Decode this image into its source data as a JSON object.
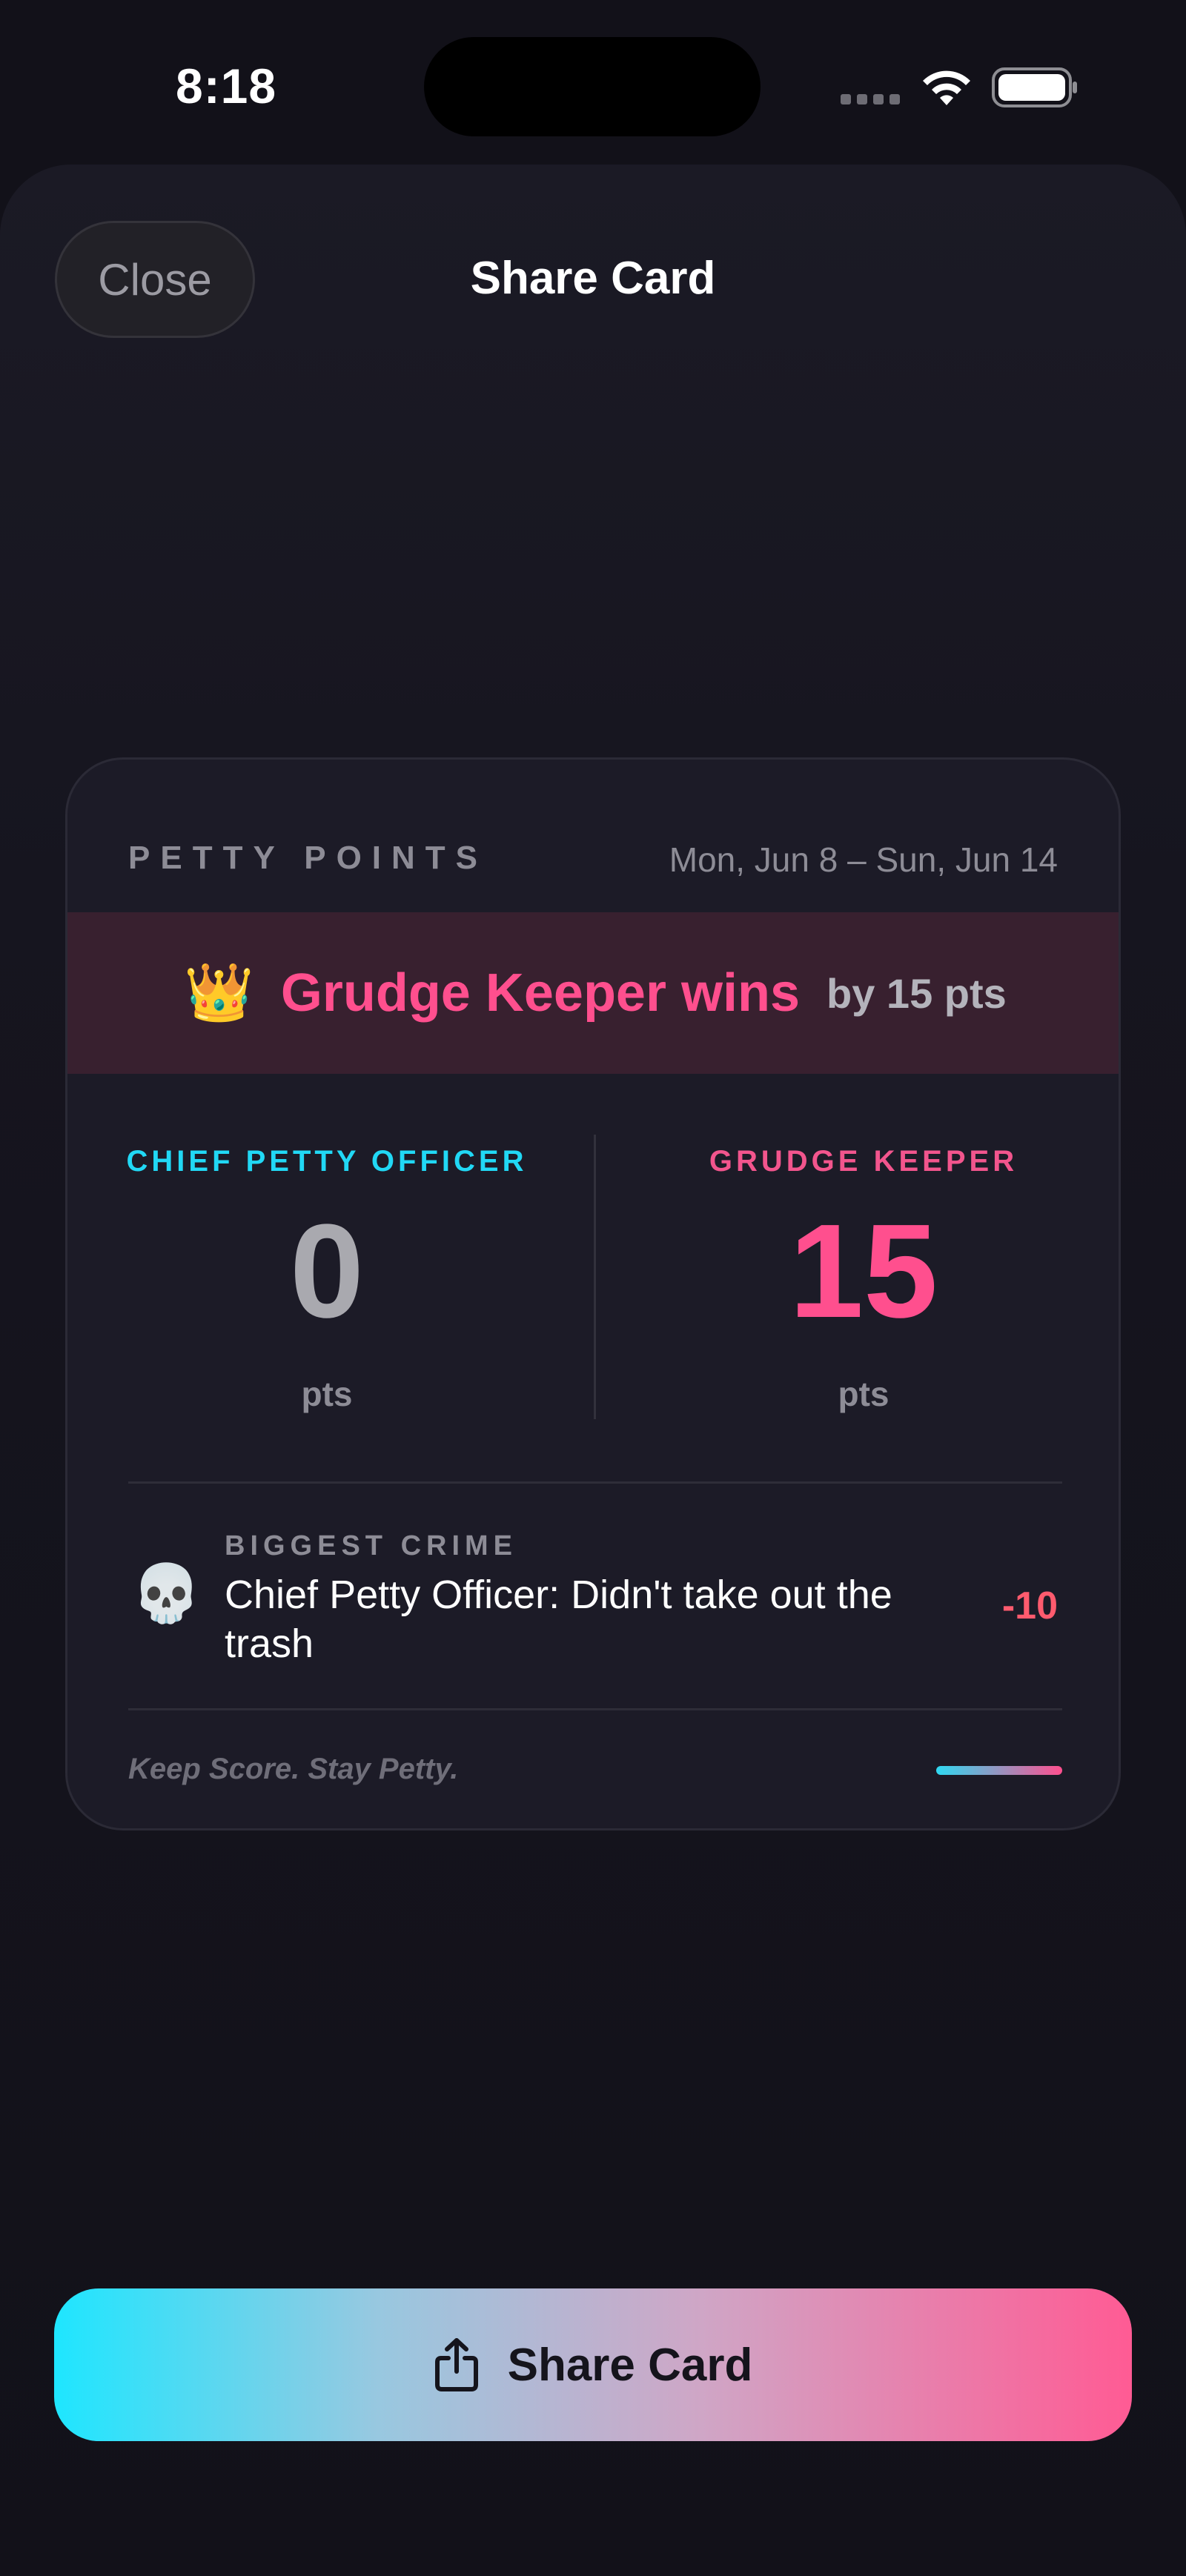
{
  "status_bar": {
    "time": "8:18",
    "icons": [
      "cellular-signal-icon",
      "wifi-icon",
      "battery-icon"
    ]
  },
  "sheet": {
    "close_label": "Close",
    "title": "Share Card"
  },
  "card": {
    "brand": "PETTY POINTS",
    "date_range": "Mon, Jun 8 – Sun, Jun 14",
    "winner": {
      "icon": "crown-icon",
      "text": "Grudge Keeper wins",
      "margin": "by 15 pts"
    },
    "players": [
      {
        "name": "CHIEF PETTY OFFICER",
        "score": "0",
        "unit": "pts",
        "color": "#21d8f5"
      },
      {
        "name": "GRUDGE KEEPER",
        "score": "15",
        "unit": "pts",
        "color": "#f2558d"
      }
    ],
    "biggest_crime": {
      "icon": "skull-icon",
      "label": "BIGGEST CRIME",
      "text": "Chief Petty Officer: Didn't take out the trash",
      "points": "-10"
    },
    "tagline": "Keep Score. Stay Petty."
  },
  "share_button": {
    "label": "Share Card",
    "icon": "share-icon"
  },
  "colors": {
    "background": "#121119",
    "accent_cyan": "#1ee6ff",
    "accent_pink": "#ff4f8e",
    "winner_band": "#38202f"
  }
}
